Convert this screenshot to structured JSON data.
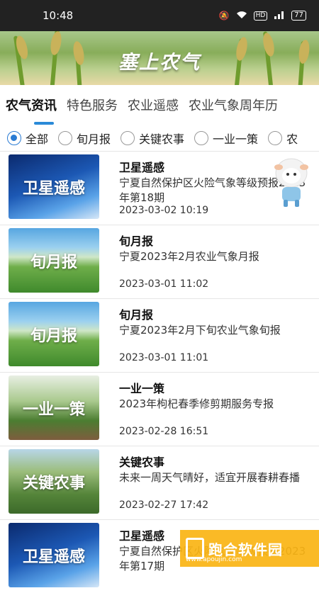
{
  "status": {
    "time": "10:48",
    "hd": "HD",
    "battery": "77"
  },
  "banner": {
    "title": "塞上农气"
  },
  "tabs": [
    {
      "label": "农气资讯"
    },
    {
      "label": "特色服务"
    },
    {
      "label": "农业遥感"
    },
    {
      "label": "农业气象周年历"
    }
  ],
  "filters": [
    {
      "label": "全部",
      "selected": true
    },
    {
      "label": "旬月报"
    },
    {
      "label": "关键农事"
    },
    {
      "label": "一业一策"
    },
    {
      "label": "农"
    }
  ],
  "items": [
    {
      "thumb": "卫星遥感",
      "title": "卫星遥感",
      "desc": "宁夏自然保护区火险气象等级预报2023年第18期",
      "date": "2023-03-02 10:19"
    },
    {
      "thumb": "旬月报",
      "title": "旬月报",
      "desc": "宁夏2023年2月农业气象月报",
      "date": "2023-03-01 11:02"
    },
    {
      "thumb": "旬月报",
      "title": "旬月报",
      "desc": "宁夏2023年2月下旬农业气象旬报",
      "date": "2023-03-01 11:01"
    },
    {
      "thumb": "一业一策",
      "title": "一业一策",
      "desc": "2023年枸杞春季修剪期服务专报",
      "date": "2023-02-28 16:51"
    },
    {
      "thumb": "关键农事",
      "title": "关键农事",
      "desc": "未来一周天气晴好，适宜开展春耕春播",
      "date": "2023-02-27 17:42"
    },
    {
      "thumb": "卫星遥感",
      "title": "卫星遥感",
      "desc": "宁夏自然保护区火险气象等级预报2023年第17期",
      "date": ""
    }
  ],
  "watermark": {
    "text": "跑合软件园",
    "sub": "www.apoujin.com"
  }
}
